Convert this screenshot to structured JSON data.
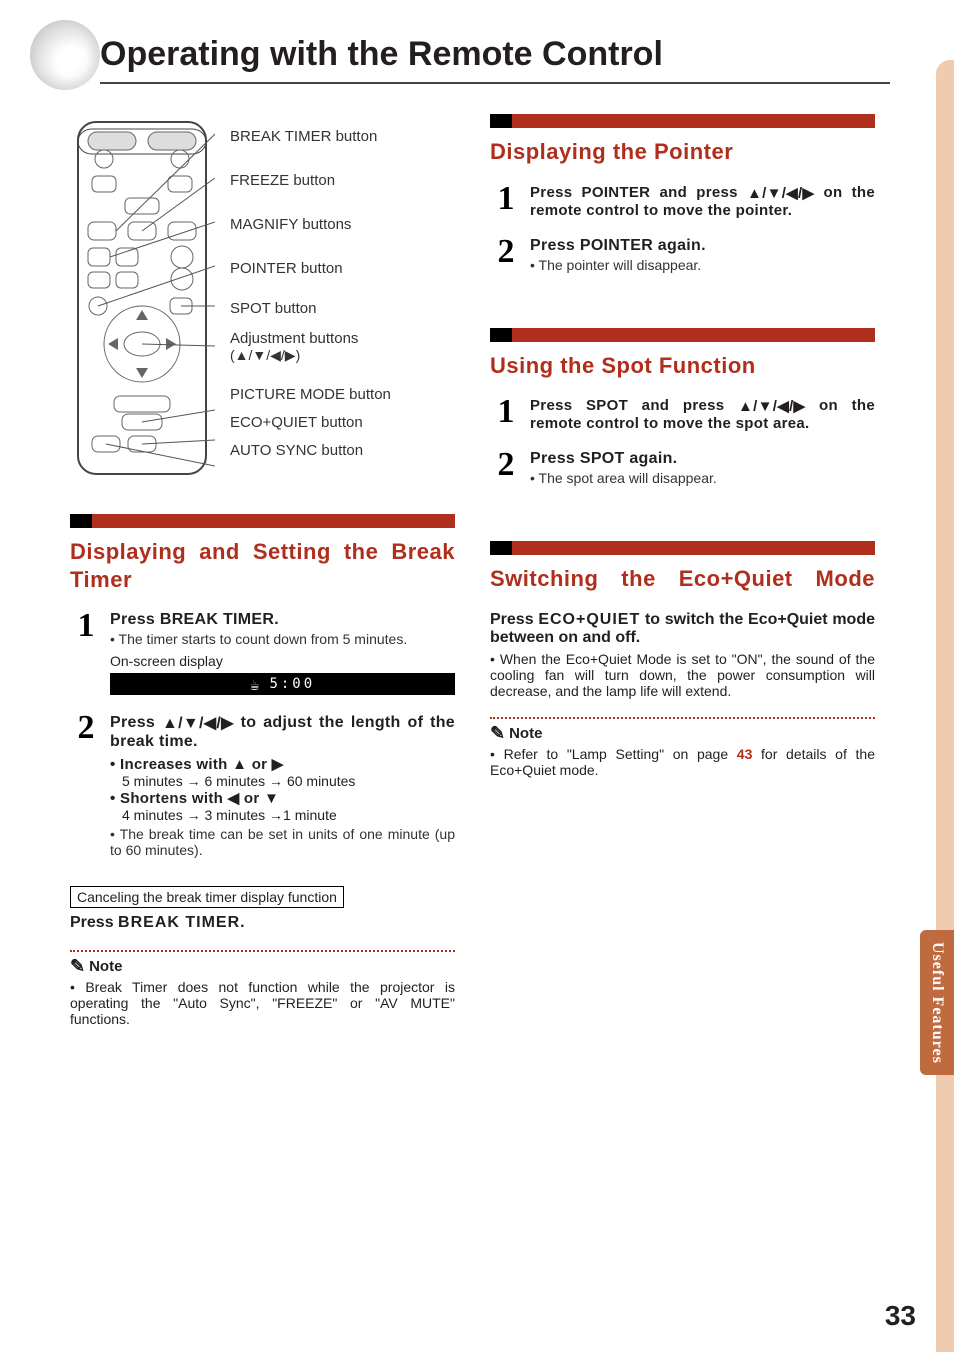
{
  "pageTitle": "Operating with the Remote Control",
  "pageNumber": "33",
  "sideTab": "Useful Features",
  "callouts": {
    "breakTimer": "BREAK TIMER button",
    "freeze": "FREEZE button",
    "magnify": "MAGNIFY buttons",
    "pointer": "POINTER button",
    "spot": "SPOT button",
    "adjust": "Adjustment buttons",
    "adjustArrows": "(▲/▼/◀/▶)",
    "pictureMode": "PICTURE MODE button",
    "ecoQuiet": "ECO+QUIET button",
    "autoSync": "AUTO SYNC button"
  },
  "left": {
    "sec1Heading": "Displaying and Setting the Break Timer",
    "step1": {
      "num": "1",
      "leadPrefix": "Press ",
      "btn": "BREAK TIMER",
      "leadSuffix": ".",
      "bullet": "The timer starts to count down from 5 minutes.",
      "osdLabel": "On-screen display",
      "osdTime": "5:00"
    },
    "step2": {
      "num": "2",
      "leadPrefix": "Press ",
      "leadArrows": "▲/▼/◀/▶",
      "leadSuffix": " to adjust the length of the break time.",
      "incLabel": "Increases with ▲ or ▶",
      "incLine": "5 minutes → 6 minutes → 60 minutes",
      "decLabel": "Shortens with ◀ or ▼",
      "decLine": "4 minutes → 3 minutes →1 minute",
      "unitNote": "The break time can be set in units of one minute (up to 60 minutes)."
    },
    "cancelBox": "Canceling the break timer display function",
    "cancelPressPrefix": "Press ",
    "cancelPressBtn": "BREAK TIMER",
    "cancelPressSuffix": ".",
    "noteLabel": "Note",
    "noteBody": "Break Timer does not function while the projector is operating the \"Auto Sync\", \"FREEZE\" or \"AV MUTE\" functions."
  },
  "right": {
    "sec1Heading": "Displaying the Pointer",
    "sec1": {
      "step1": {
        "num": "1",
        "pre": "Press ",
        "btn": "POINTER",
        "mid": " and press ",
        "arrows": "▲/▼/◀/▶",
        "post": " on the remote control to move the pointer."
      },
      "step2": {
        "num": "2",
        "pre": "Press ",
        "btn": "POINTER",
        "post": " again.",
        "sub": "The pointer will disappear."
      }
    },
    "sec2Heading": "Using the Spot Function",
    "sec2": {
      "step1": {
        "num": "1",
        "pre": "Press ",
        "btn": "SPOT",
        "mid": " and press ",
        "arrows": "▲/▼/◀/▶",
        "post": " on the remote control to move the spot area."
      },
      "step2": {
        "num": "2",
        "pre": "Press ",
        "btn": "SPOT",
        "post": " again.",
        "sub": "The spot area will disappear."
      }
    },
    "sec3Heading": "Switching the Eco+Quiet Mode",
    "sec3": {
      "leadPre": "Press ",
      "leadBtn": "ECO+QUIET",
      "leadPost": " to switch the Eco+Quiet mode between on and off.",
      "bullet": "When the Eco+Quiet Mode is set to \"ON\", the sound of the cooling fan will turn down, the power consumption will decrease, and the lamp life will extend.",
      "noteLabel": "Note",
      "noteBodyPre": "Refer to \"Lamp Setting\" on page ",
      "noteRef": "43",
      "noteBodyPost": " for details of the Eco+Quiet mode."
    }
  }
}
